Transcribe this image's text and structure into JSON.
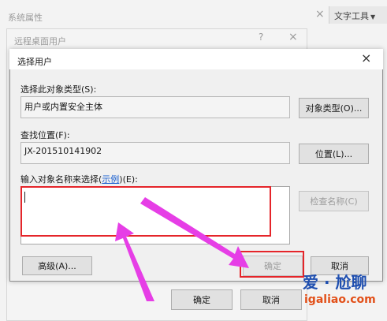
{
  "background": {
    "window1_title": "系统属性",
    "tab_label": "文字工具",
    "window2_title": "远程桌面用户",
    "help_glyph": "?",
    "close_glyph": "×"
  },
  "dialog": {
    "title": "选择用户",
    "close_glyph": "×",
    "object_type_label": "选择此对象类型(S):",
    "object_type_value": "用户或内置安全主体",
    "object_type_button": "对象类型(O)...",
    "location_label": "查找位置(F):",
    "location_value": "JX-201510141902",
    "location_button": "位置(L)...",
    "names_label_prefix": "输入对象名称来选择(",
    "names_label_link": "示例",
    "names_label_suffix": ")(E):",
    "names_value": "",
    "check_names_button": "检查名称(C)",
    "advanced_button": "高级(A)...",
    "ok_button": "确定",
    "cancel_button": "取消"
  },
  "background_footer": {
    "ok_button": "确定",
    "cancel_button": "取消"
  },
  "watermark": {
    "line1": "爱 · 尬聊",
    "line2": "igaliao.com"
  },
  "colors": {
    "highlight_red": "#e5252a",
    "arrow_magenta": "#e63ee6",
    "link_blue": "#1a5fd0",
    "watermark_blue": "#1f4fb0",
    "watermark_orange": "#e25019"
  }
}
